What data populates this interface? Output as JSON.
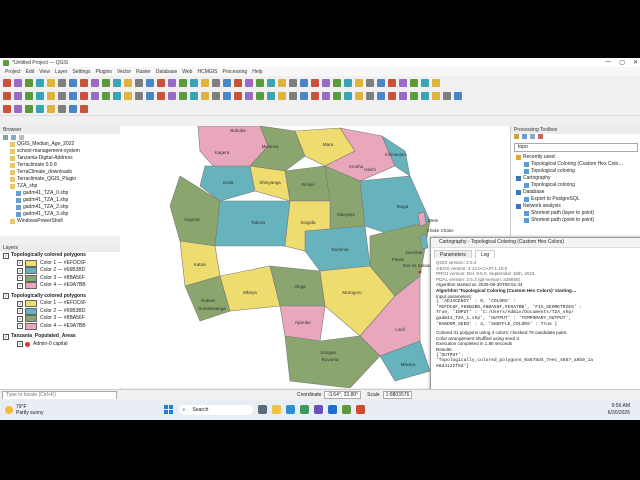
{
  "window": {
    "title": "*Untitled Project — QGIS",
    "controls": [
      "—",
      "▢",
      "✕"
    ]
  },
  "menu": [
    "Project",
    "Edit",
    "View",
    "Layer",
    "Settings",
    "Plugins",
    "Vector",
    "Raster",
    "Database",
    "Web",
    "HCMGIS",
    "Processing",
    "Help"
  ],
  "browser": {
    "title": "Browser",
    "items": [
      "QGIS_Median_Age_2022",
      "school-management-system",
      "Tanzania-Digital-Address",
      "Terraclimate 0.0.8",
      "TerraClimate_downloads",
      "Terraclimate_QGIS_Plugin",
      "TZA_shp",
      "gadm41_TZA_0.shp",
      "gadm41_TZA_1.shp",
      "gadm41_TZA_2.shp",
      "gadm41_TZA_3.shp",
      "WindowsPowerShell"
    ]
  },
  "layers": {
    "title": "Layers",
    "groups": [
      {
        "name": "Topologically colored polygons",
        "items": [
          {
            "label": "Color 1 — #EFDC6F",
            "color": "#EFDC6F"
          },
          {
            "label": "Color 2 — #66B3BD",
            "color": "#66B3BD"
          },
          {
            "label": "Color 3 — #8BA56F",
            "color": "#8BA56F"
          },
          {
            "label": "Color 4 — #E9A7BB",
            "color": "#E9A7BB"
          }
        ]
      },
      {
        "name": "Topologically colored polygons",
        "items": [
          {
            "label": "Color 1 — #EFDC6F",
            "color": "#EFDC6F"
          },
          {
            "label": "Color 2 — #66B3BD",
            "color": "#66B3BD"
          },
          {
            "label": "Color 3 — #8BA56F",
            "color": "#8BA56F"
          },
          {
            "label": "Color 4 — #E9A7BB",
            "color": "#E9A7BB"
          }
        ]
      }
    ],
    "extra": [
      "Tanzania_Populated_Areas",
      "Admin-0 capital"
    ]
  },
  "map": {
    "labels": [
      "Bukoba",
      "Kagera",
      "Mwanza",
      "Mara",
      "Arusha",
      "Kilimanjaro",
      "Hachi",
      "Geita",
      "Tanga",
      "Shinyanga",
      "Simiyu",
      "Manyara",
      "Tabora",
      "Singida",
      "Dodoma",
      "Kigoma",
      "Katavi",
      "Rukwa",
      "Sumbawanga",
      "Mbeya",
      "Iringa",
      "Njombe",
      "Morogoro",
      "Zanzibar",
      "Pwani",
      "Lindi",
      "Ruvuma",
      "Songea",
      "Mtwara",
      "Wete",
      "Chake Chake",
      "Mkoani",
      "Dar es Salaam"
    ]
  },
  "toolbox": {
    "title": "Processing Toolbox",
    "search": "topo",
    "items": [
      "Recently used",
      "Topological Coloring (Custom Hex Colo…",
      "Topological coloring",
      "Cartography",
      "Topological coloring",
      "Database",
      "Export to PostgreSQL",
      "Network analysis",
      "Shortest path (layer to point)",
      "Shortest path (point to point)"
    ]
  },
  "dialog": {
    "title": "Cartography - Topological Coloring (Custom Hex Colors)",
    "tabs": [
      "Parameters",
      "Log"
    ],
    "log": [
      "QGIS version: 3.5.3",
      "GEOS version: 3.13.0-CAPI-1.19.0",
      "PROJ version: Rel. 9.5.0, September 15th, 2024",
      "PDAL version: 2.5.3 (git-version: a38658)",
      "Algorithm started at: 2026-06-30T06:51:44",
      "Algorithm 'Topological Coloring (Custom Hex Colors)' starting…",
      "Input parameters:",
      "{ 'ADJACENCY' : 0, 'COLORS' :",
      "'#EFDC6F,#66B3BD,#8BA56F,#E9A7BB', 'FIX_GEOMETRIES' :",
      "True, 'INPUT' : 'C:/Users/Admin/Documents/TZA_shp/",
      "gadm41_TZA_1.shp', 'OUTPUT' : 'TEMPORARY_OUTPUT',",
      "'RANDOM_SEED' : 3, 'SHUFFLE_COLORS' : True }",
      "Colored 31 polygons using 4 colors; checked 78 candidate pairs.",
      "Color arrangement shuffled using seed 3.",
      "Execution completed in 1.86 seconds",
      "Results:",
      "{'OUTPUT':",
      "'Topologically_colored_polygons_0a578d4_7eec_4657_a8b9_1a",
      "68d4122f6d'}"
    ]
  },
  "status": {
    "locator_placeholder": "Type to locate (Ctrl+K)",
    "coordinate_label": "Coordinate",
    "coordinate": "-3.64°, 33.80°",
    "scale_label": "Scale",
    "scale": "1:8803576"
  },
  "taskbar": {
    "weather_temp": "79°F",
    "weather_desc": "Partly sunny",
    "search": "Search",
    "time": "9:56 AM",
    "date": "6/30/2026"
  },
  "colors": {
    "c1": "#EFDC6F",
    "c2": "#66B3BD",
    "c3": "#8BA56F",
    "c4": "#E9A7BB"
  }
}
